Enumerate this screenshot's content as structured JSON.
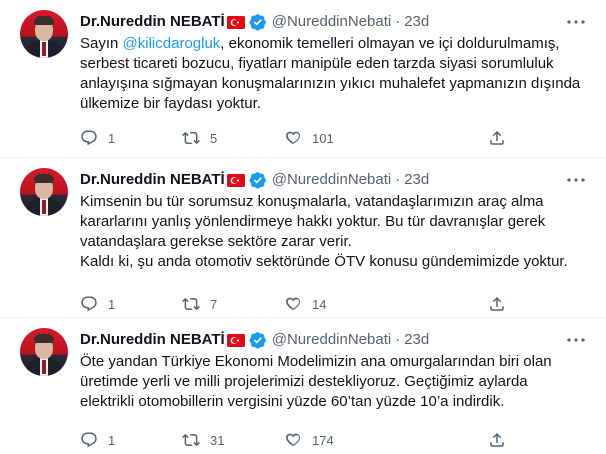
{
  "tweets": [
    {
      "name": "Dr.Nureddin NEBATİ",
      "handle": "@NureddinNebati",
      "separator": "·",
      "time": "23d",
      "text_parts": [
        {
          "text": "Sayın "
        },
        {
          "text": "@kilicdarogluk",
          "mention": true
        },
        {
          "text": ", ekonomik temelleri olmayan ve içi doldurulmamış,\nserbest ticareti bozucu, fiyatları manipüle eden tarzda siyasi sorumluluk\nanlayışına sığmayan konuşmalarınızın yıkıcı muhalefet yapmanızın dışında\nülkemize bir faydası yoktur."
        }
      ],
      "replies": "1",
      "retweets": "5",
      "likes": "101"
    },
    {
      "name": "Dr.Nureddin NEBATİ",
      "handle": "@NureddinNebati",
      "separator": "·",
      "time": "23d",
      "text_parts": [
        {
          "text": "Kimsenin bu tür sorumsuz konuşmalarla, vatandaşlarımızın araç alma\nkararlarını yanlış yönlendirmeye hakkı yoktur. Bu tür davranışlar gerek\nvatandaşlara gerekse sektöre zarar verir.\nKaldı ki, şu anda otomotiv sektöründe ÖTV konusu gündemimizde yoktur."
        }
      ],
      "replies": "1",
      "retweets": "7",
      "likes": "14"
    },
    {
      "name": "Dr.Nureddin NEBATİ",
      "handle": "@NureddinNebati",
      "separator": "·",
      "time": "23d",
      "text_parts": [
        {
          "text": "Öte yandan Türkiye Ekonomi Modelimizin ana omurgalarından biri olan\nüretimde yerli ve milli projelerimizi destekliyoruz. Geçtiğimiz aylarda\nelektrikli otomobillerin vergisini yüzde 60’tan yüzde 10’a indirdik."
        }
      ],
      "replies": "1",
      "retweets": "31",
      "likes": "174"
    }
  ],
  "icons": {
    "avatar": "profile-photo",
    "flag": "turkey-flag-icon",
    "verified": "verified-badge-icon",
    "more": "more-options-icon",
    "reply": "reply-icon",
    "retweet": "retweet-icon",
    "like": "like-heart-icon",
    "share": "share-icon"
  },
  "colors": {
    "text": "#0f1419",
    "secondary": "#536471",
    "accent": "#1d9bf0",
    "flag_red": "#e30a17",
    "divider": "#eff3f4"
  }
}
